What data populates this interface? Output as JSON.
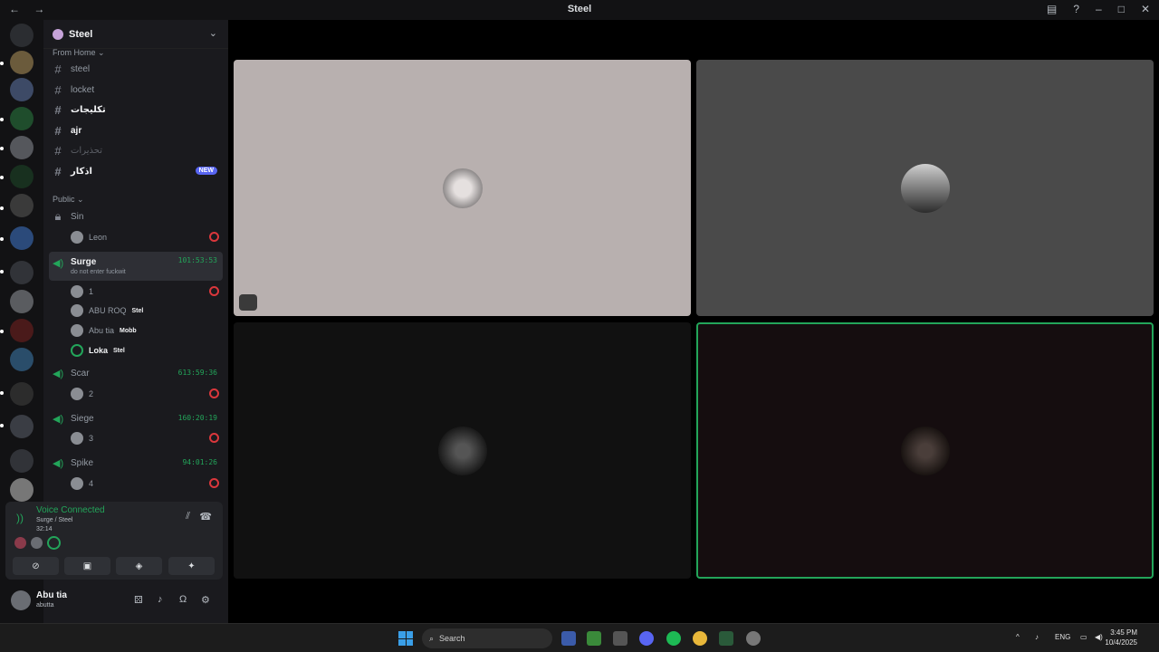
{
  "window": {
    "title": "Steel",
    "nav": "← →"
  },
  "servers": {
    "count": 15
  },
  "guild": {
    "name": "Steel",
    "chevron": "⌄"
  },
  "categories": {
    "from_home": "From Home ⌄",
    "public": "Public ⌄"
  },
  "text_channels": [
    {
      "name": "steel"
    },
    {
      "name": "locket"
    },
    {
      "name": "تكليجات"
    },
    {
      "name": "ajr"
    },
    {
      "name": "تحذيرات"
    },
    {
      "name": "اذكار",
      "badge": "NEW"
    }
  ],
  "voice": {
    "sin": {
      "name": "Sin",
      "users": [
        {
          "name": "Leon"
        }
      ]
    },
    "surge": {
      "name": "Surge",
      "status": "do not enter fuckwit",
      "timer": "101:53:53",
      "users": [
        {
          "name": "1"
        },
        {
          "name": "ABU ROQ",
          "tag": "Stel"
        },
        {
          "name": "Abu tia",
          "tag": "Mobb"
        },
        {
          "name": "Loka",
          "tag": "Stel"
        }
      ]
    },
    "scar": {
      "name": "Scar",
      "timer": "613:59:36",
      "users": [
        {
          "name": "2"
        }
      ]
    },
    "siege": {
      "name": "Siege",
      "timer": "160:20:19",
      "users": [
        {
          "name": "3"
        }
      ]
    },
    "spike": {
      "name": "Spike",
      "timer": "94:01:26",
      "users": [
        {
          "name": "4"
        }
      ]
    }
  },
  "panel": {
    "status": "Voice Connected",
    "path": "Surge / Steel",
    "time": "32:14"
  },
  "account": {
    "name": "Abu tia",
    "status": "abutta"
  },
  "taskbar": {
    "search": "Search",
    "lang": "ENG",
    "time": "3:45 PM",
    "date": "10/4/2025"
  },
  "colors": {
    "accent": "#23a55a",
    "tile1": "#b8b0af",
    "tile2": "#4a4a4a",
    "tile3": "#111111",
    "tile4": "#150d0f"
  }
}
